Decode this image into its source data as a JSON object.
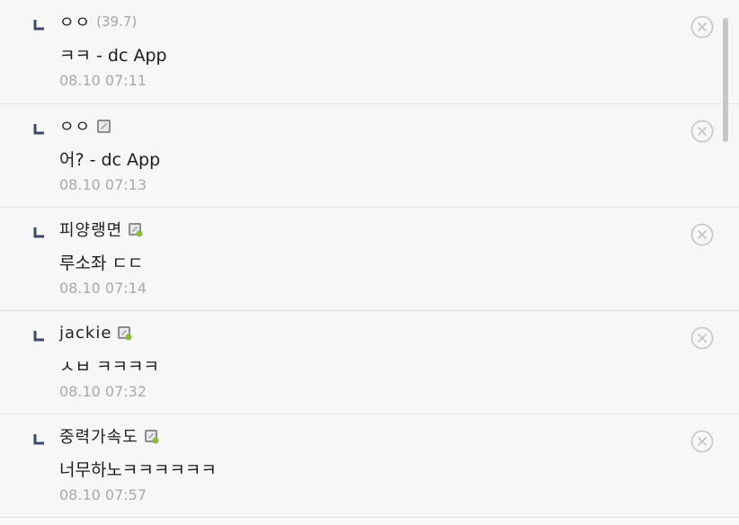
{
  "comments": [
    {
      "nick": "ㅇㅇ",
      "ip": "(39.7)",
      "badge": "",
      "text": "ㅋㅋ - dc App",
      "date": "08.10 07:11"
    },
    {
      "nick": "ㅇㅇ",
      "ip": "",
      "badge": "fixed-member-badge-icon",
      "text": "어? - dc App",
      "date": "08.10 07:13"
    },
    {
      "nick": "피양랭면",
      "ip": "",
      "badge": "half-member-badge-icon",
      "text": "루소좌 ㄷㄷ",
      "date": "08.10 07:14"
    },
    {
      "nick": "jackie",
      "ip": "",
      "badge": "half-member-badge-icon",
      "text": "ㅅㅂ ㅋㅋㅋㅋ",
      "date": "08.10 07:32"
    },
    {
      "nick": "중력가속도",
      "ip": "",
      "badge": "half-member-badge-icon",
      "text": "너무하노ㅋㅋㅋㅋㅋㅋ",
      "date": "08.10 07:57"
    }
  ],
  "colors": {
    "background": "#f7f7f8",
    "divider": "#e1e1e5",
    "reply_mark": "#3b4a6b",
    "meta_text": "#a8a8ad",
    "delete_icon": "#c4c4c8",
    "scrollbar": "#c6c6ca"
  },
  "icons": {
    "reply": "reply-arrow-icon",
    "delete": "delete-circle-x-icon"
  }
}
